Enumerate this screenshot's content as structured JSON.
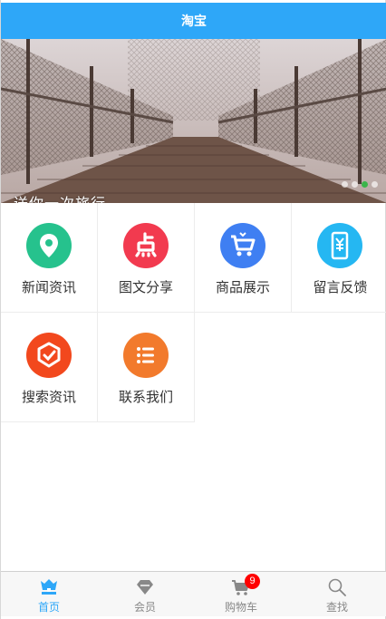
{
  "header": {
    "title": "淘宝"
  },
  "banner": {
    "caption": "送你一次旅行",
    "slide_count": 4,
    "active_slide": 3,
    "active_dot_color": "#39b54a"
  },
  "grid": {
    "items": [
      {
        "label": "新闻资讯",
        "icon": "location-pin-icon",
        "color": "#26c28d"
      },
      {
        "label": "图文分享",
        "icon": "dian-text-icon",
        "color": "#f23a4f"
      },
      {
        "label": "商品展示",
        "icon": "shopping-cart-icon",
        "color": "#3f7ff2"
      },
      {
        "label": "留言反馈",
        "icon": "phone-yen-icon",
        "color": "#25b7f2"
      },
      {
        "label": "搜索资讯",
        "icon": "check-shield-icon",
        "color": "#f2481d"
      },
      {
        "label": "联系我们",
        "icon": "list-icon",
        "color": "#f27a2c"
      }
    ]
  },
  "tabbar": {
    "tabs": [
      {
        "label": "首页",
        "icon": "home-icon",
        "active": true
      },
      {
        "label": "会员",
        "icon": "diamond-icon",
        "active": false
      },
      {
        "label": "购物车",
        "icon": "cart-icon",
        "active": false,
        "badge": "9"
      },
      {
        "label": "查找",
        "icon": "search-icon",
        "active": false
      }
    ]
  },
  "colors": {
    "header": "#2ea7f8",
    "tab_active": "#2ea7f8",
    "tab_inactive": "#888888",
    "badge": "#ff0000"
  }
}
